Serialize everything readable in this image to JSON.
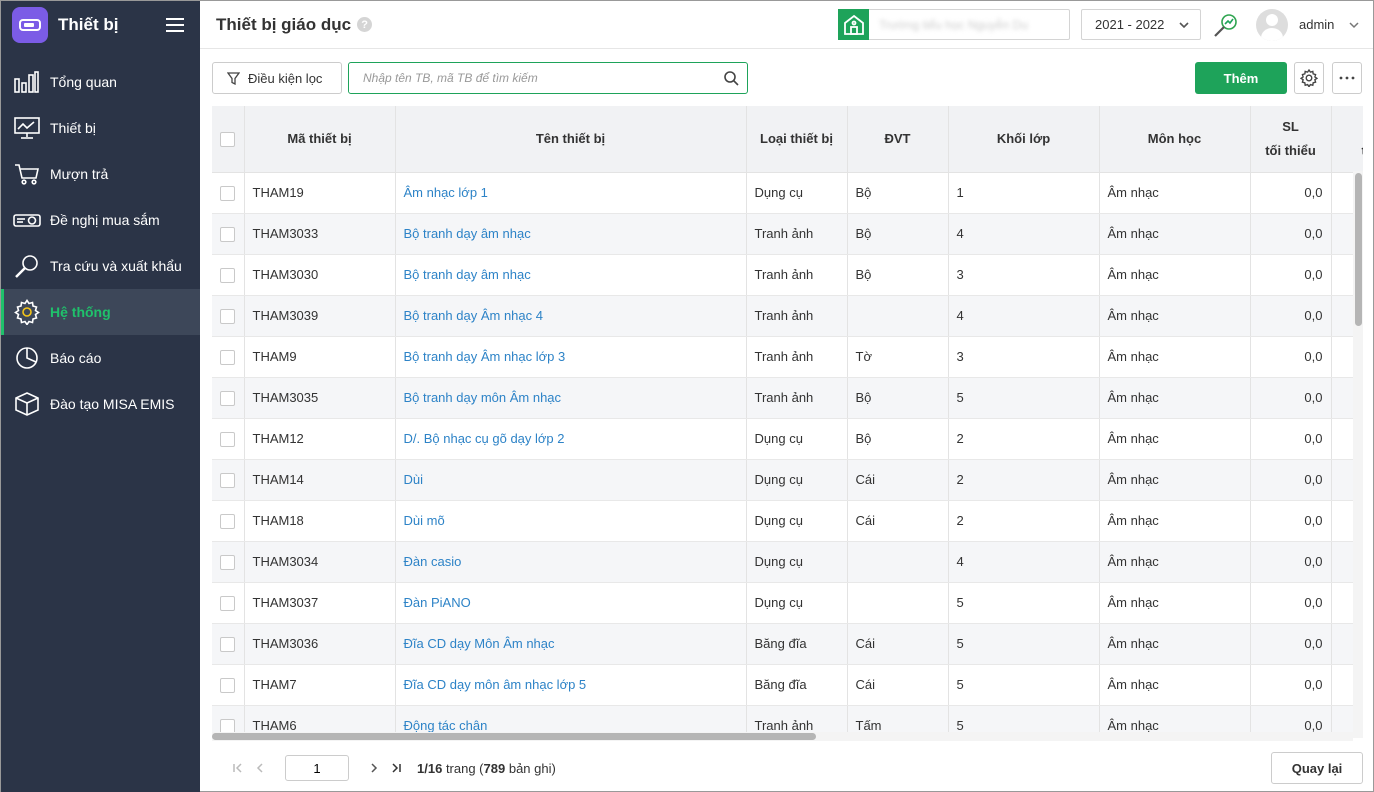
{
  "sidebar": {
    "title": "Thiết bị",
    "items": [
      {
        "label": "Tổng quan",
        "icon": "chart-bars-icon",
        "active": false
      },
      {
        "label": "Thiết bị",
        "icon": "monitor-icon",
        "active": false
      },
      {
        "label": "Mượn trả",
        "icon": "cart-icon",
        "active": false
      },
      {
        "label": "Đề nghị mua sắm",
        "icon": "projector-icon",
        "active": false
      },
      {
        "label": "Tra cứu và xuất khẩu",
        "icon": "search-icon",
        "active": false
      },
      {
        "label": "Hệ thống",
        "icon": "gear-icon",
        "active": true
      },
      {
        "label": "Báo cáo",
        "icon": "pie-chart-icon",
        "active": false
      },
      {
        "label": "Đào tạo MISA EMIS",
        "icon": "box-icon",
        "active": false
      }
    ]
  },
  "header": {
    "title": "Thiết bị giáo dục",
    "help": "?",
    "school_name": "Trường tiểu học Nguyễn Du",
    "year": "2021 - 2022",
    "username": "admin"
  },
  "toolbar": {
    "filter_label": "Điều kiện lọc",
    "search_placeholder": "Nhập tên TB, mã TB để tìm kiếm",
    "add_label": "Thêm"
  },
  "table": {
    "columns": [
      "Mã thiết bị",
      "Tên thiết bị",
      "Loại thiết bị",
      "ĐVT",
      "Khối lớp",
      "Môn học",
      "SL",
      "tối thiểu",
      "T",
      "tự"
    ],
    "rows": [
      {
        "code": "THAM19",
        "name": "Âm nhạc lớp 1",
        "type": "Dụng cụ",
        "unit": "Bộ",
        "grade": "1",
        "subject": "Âm nhạc",
        "min": "0,0"
      },
      {
        "code": "THAM3033",
        "name": "Bộ tranh dạy âm nhạc",
        "type": "Tranh ảnh",
        "unit": "Bộ",
        "grade": "4",
        "subject": "Âm nhạc",
        "min": "0,0"
      },
      {
        "code": "THAM3030",
        "name": "Bộ tranh dạy âm nhạc",
        "type": "Tranh ảnh",
        "unit": "Bộ",
        "grade": "3",
        "subject": "Âm nhạc",
        "min": "0,0"
      },
      {
        "code": "THAM3039",
        "name": "Bộ tranh dạy Âm nhạc 4",
        "type": "Tranh ảnh",
        "unit": "",
        "grade": "4",
        "subject": "Âm nhạc",
        "min": "0,0"
      },
      {
        "code": "THAM9",
        "name": "Bộ tranh dạy Âm nhạc lớp 3",
        "type": "Tranh ảnh",
        "unit": "Tờ",
        "grade": "3",
        "subject": "Âm nhạc",
        "min": "0,0"
      },
      {
        "code": "THAM3035",
        "name": "Bộ tranh dạy môn Âm nhạc",
        "type": "Tranh ảnh",
        "unit": "Bộ",
        "grade": "5",
        "subject": "Âm nhạc",
        "min": "0,0"
      },
      {
        "code": "THAM12",
        "name": "D/. Bộ nhạc cụ gõ dạy lớp 2",
        "type": "Dụng cụ",
        "unit": "Bộ",
        "grade": "2",
        "subject": "Âm nhạc",
        "min": "0,0"
      },
      {
        "code": "THAM14",
        "name": "Dùi",
        "type": "Dụng cụ",
        "unit": "Cái",
        "grade": "2",
        "subject": "Âm nhạc",
        "min": "0,0"
      },
      {
        "code": "THAM18",
        "name": "Dùi mõ",
        "type": "Dụng cụ",
        "unit": "Cái",
        "grade": "2",
        "subject": "Âm nhạc",
        "min": "0,0"
      },
      {
        "code": "THAM3034",
        "name": "Đàn casio",
        "type": "Dụng cụ",
        "unit": "",
        "grade": "4",
        "subject": "Âm nhạc",
        "min": "0,0"
      },
      {
        "code": "THAM3037",
        "name": "Đàn PiANO",
        "type": "Dụng cụ",
        "unit": "",
        "grade": "5",
        "subject": "Âm nhạc",
        "min": "0,0"
      },
      {
        "code": "THAM3036",
        "name": "Đĩa CD dạy Môn Âm nhạc",
        "type": "Băng đĩa",
        "unit": "Cái",
        "grade": "5",
        "subject": "Âm nhạc",
        "min": "0,0"
      },
      {
        "code": "THAM7",
        "name": "Đĩa CD dạy môn âm nhạc lớp 5",
        "type": "Băng đĩa",
        "unit": "Cái",
        "grade": "5",
        "subject": "Âm nhạc",
        "min": "0,0"
      },
      {
        "code": "THAM6",
        "name": "Động tác chân",
        "type": "Tranh ảnh",
        "unit": "Tấm",
        "grade": "5",
        "subject": "Âm nhạc",
        "min": "0,0"
      }
    ]
  },
  "pagination": {
    "current_page": "1",
    "page_of": "1/16",
    "trang": "trang (",
    "records": "789",
    "records_suffix": "bản ghi)",
    "back_label": "Quay lại"
  },
  "colors": {
    "sidebar_bg": "#2b3447",
    "accent_green": "#1ea35a",
    "link_blue": "#2d83c7"
  }
}
